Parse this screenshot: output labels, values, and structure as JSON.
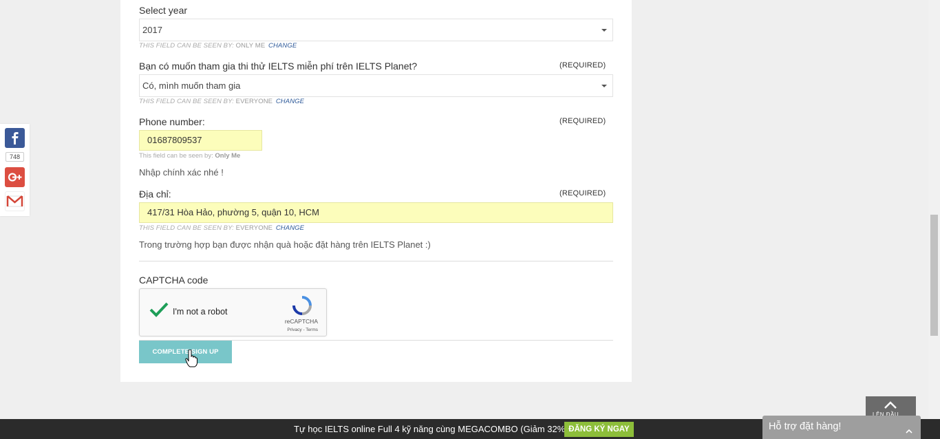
{
  "form": {
    "year": {
      "label": "Select year",
      "value": "2017",
      "visibility_prefix": "This field can be seen by:",
      "visibility_who": "Only Me",
      "change": "Change"
    },
    "free_test": {
      "label": "Bạn có muốn tham gia thi thử IELTS miễn phí trên IELTS Planet?",
      "required": "(REQUIRED)",
      "value": "Có, mình muốn tham gia",
      "visibility_prefix": "This field can be seen by:",
      "visibility_who": "Everyone",
      "change": "Change"
    },
    "phone": {
      "label": "Phone number:",
      "required": "(REQUIRED)",
      "value": "01687809537",
      "visibility_prefix": "This field can be seen by:",
      "visibility_who": "Only Me",
      "hint": "Nhập chính xác nhé !"
    },
    "address": {
      "label": "Địa chỉ:",
      "required": "(REQUIRED)",
      "value": "417/31 Hòa Hảo, phường 5, quận 10, HCM",
      "visibility_prefix": "This field can be seen by:",
      "visibility_who": "Everyone",
      "change": "Change",
      "hint": "Trong trường hợp bạn được nhận quà hoặc đặt hàng trên IELTS Planet :)"
    },
    "captcha": {
      "label": "CAPTCHA code",
      "checkbox_text": "I'm not a robot",
      "brand": "reCAPTCHA",
      "links": "Privacy - Terms"
    },
    "submit_label": "Complete Sign Up"
  },
  "share": {
    "count": "748",
    "icons": [
      "facebook-icon",
      "google-plus-icon",
      "gmail-icon"
    ]
  },
  "bottom_bar": {
    "promo": "Tự học IELTS online Full 4 kỹ năng cùng MEGACOMBO (Giảm 32%)",
    "cta": "ĐĂNG KÝ NGAY"
  },
  "to_top": {
    "label": "LÊN ĐẦU"
  },
  "chat": {
    "title": "Hỗ trợ đặt hàng!"
  },
  "colors": {
    "submit_button": "#79c6c9",
    "input_highlight": "#fcfdbb",
    "cta_green": "#8dbe3a",
    "facebook": "#3b5998",
    "google_plus": "#dc4e41",
    "change_link": "#2e5a99"
  }
}
